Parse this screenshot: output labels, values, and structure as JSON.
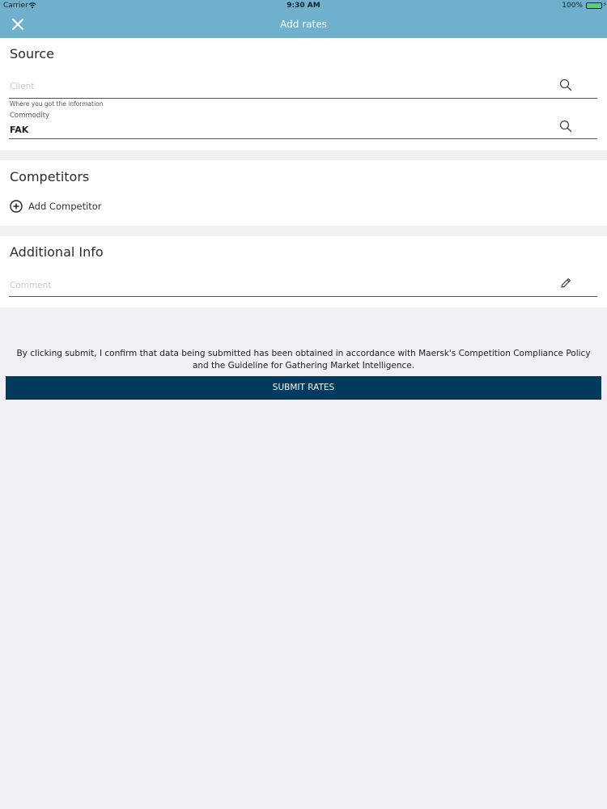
{
  "status_bar": {
    "carrier": "Carrier",
    "time": "9:30 AM",
    "battery": "100%",
    "battery_level": 1.0
  },
  "header": {
    "title": "Add rates",
    "close_icon": "close-icon"
  },
  "source": {
    "title": "Source",
    "client": {
      "placeholder": "Client",
      "value": "",
      "helper": "Where you got the information"
    },
    "commodity": {
      "label": "Commodity",
      "value": "FAK"
    }
  },
  "competitors": {
    "title": "Competitors",
    "add_label": "Add Competitor"
  },
  "additional_info": {
    "title": "Additional Info",
    "comment": {
      "placeholder": "Comment",
      "value": ""
    }
  },
  "disclaimer": "By clicking submit, I confirm that data being submitted has been obtained in accordance with Maersk's Competition Compliance Policy and the Guideline for Gathering Market Intelligence.",
  "submit_label": "SUBMIT RATES",
  "colors": {
    "header_bg": "#6fb1cc",
    "submit_bg": "#003a5c",
    "page_bg": "#efeff4"
  }
}
